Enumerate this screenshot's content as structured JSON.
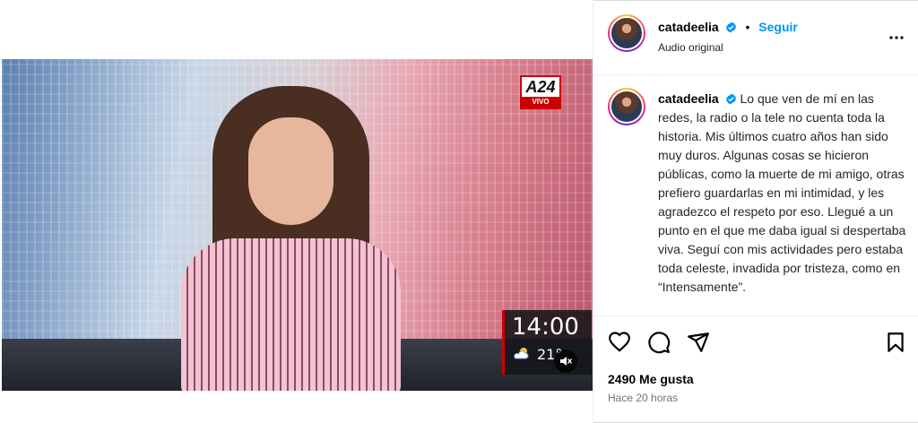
{
  "video": {
    "channel_logo": "A24",
    "channel_live": "VIVO",
    "clock": "14:00",
    "temperature": "21°",
    "weather_icon": "partly-cloudy-icon",
    "mute_icon": "muted-speaker-icon"
  },
  "header": {
    "username": "catadeelia",
    "verified": true,
    "separator": "•",
    "follow_label": "Seguir",
    "subtitle": "Audio original"
  },
  "caption": {
    "username": "catadeelia",
    "text": "Lo que ven de mí en las redes, la radio o la tele no cuenta toda la historia. Mis últimos cuatro años han sido muy duros. Algunas cosas se hicieron públicas, como la muerte de mi amigo, otras prefiero guardarlas en mi intimidad, y les agradezco el respeto por eso. Llegué a un punto en el que me daba igual si despertaba viva. Seguí con mis actividades pero estaba toda celeste, invadida por tristeza, como en “Intensamente”."
  },
  "actions": {
    "icons": [
      "heart-icon",
      "comment-icon",
      "share-icon",
      "bookmark-icon"
    ]
  },
  "stats": {
    "likes": "2490 Me gusta",
    "time_ago": "Hace 20 horas"
  },
  "colors": {
    "follow_blue": "#0095f6",
    "verified_blue": "#0095f6",
    "muted_text": "#737373"
  }
}
